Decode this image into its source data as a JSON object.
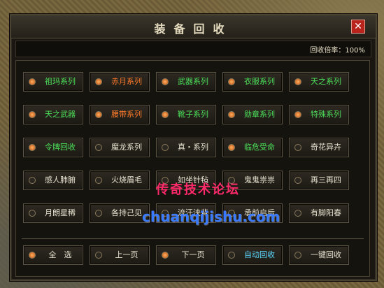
{
  "window": {
    "title": "装备回收",
    "close_label": "✕"
  },
  "rate": {
    "text": "回收倍率：100%"
  },
  "rows": [
    [
      {
        "label": "祖玛系列",
        "color": "green",
        "on": true
      },
      {
        "label": "赤月系列",
        "color": "orange",
        "on": true
      },
      {
        "label": "武器系列",
        "color": "green",
        "on": true
      },
      {
        "label": "衣服系列",
        "color": "green",
        "on": true
      },
      {
        "label": "天之系列",
        "color": "green",
        "on": true
      }
    ],
    [
      {
        "label": "天之武器",
        "color": "green",
        "on": true
      },
      {
        "label": "腰带系列",
        "color": "orange",
        "on": true
      },
      {
        "label": "靴子系列",
        "color": "green",
        "on": true
      },
      {
        "label": "勋章系列",
        "color": "green",
        "on": true
      },
      {
        "label": "特殊系列",
        "color": "green",
        "on": true
      }
    ],
    [
      {
        "label": "令牌回收",
        "color": "green",
        "on": true
      },
      {
        "label": "魔龙系列",
        "color": "white",
        "on": false
      },
      {
        "label": "真・系列",
        "color": "white",
        "on": false
      },
      {
        "label": "临危受命",
        "color": "green",
        "on": true
      },
      {
        "label": "奇花异卉",
        "color": "white",
        "on": false
      }
    ],
    [
      {
        "label": "感人肺腑",
        "color": "white",
        "on": false
      },
      {
        "label": "火烧眉毛",
        "color": "white",
        "on": false
      },
      {
        "label": "如坐针毡",
        "color": "white",
        "on": false
      },
      {
        "label": "鬼鬼祟祟",
        "color": "white",
        "on": false
      },
      {
        "label": "再三再四",
        "color": "white",
        "on": false
      }
    ],
    [
      {
        "label": "月朗星稀",
        "color": "white",
        "on": false
      },
      {
        "label": "各持己见",
        "color": "white",
        "on": false
      },
      {
        "label": "流汗浃背",
        "color": "white",
        "on": false
      },
      {
        "label": "承前启后",
        "color": "white",
        "on": false
      },
      {
        "label": "有脚阳春",
        "color": "white",
        "on": false
      }
    ]
  ],
  "actions": [
    {
      "label": "全　选",
      "color": "white",
      "on": true
    },
    {
      "label": "上一页",
      "color": "white",
      "on": false
    },
    {
      "label": "下一页",
      "color": "white",
      "on": true
    },
    {
      "label": "自动回收",
      "color": "cyan",
      "on": false
    },
    {
      "label": "一键回收",
      "color": "white",
      "on": false
    }
  ],
  "watermark": {
    "line1": "传奇技术论坛",
    "line2": "chuanqijishu.com"
  }
}
